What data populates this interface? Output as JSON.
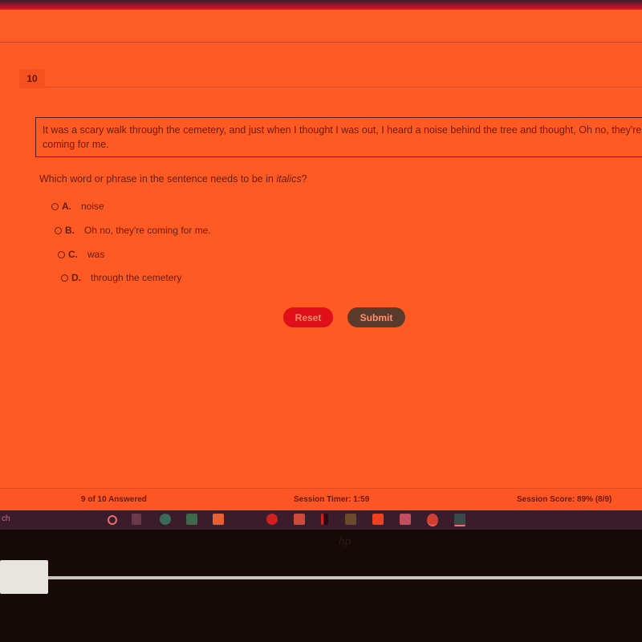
{
  "question": {
    "number": "10",
    "passage": "It was a scary walk through the cemetery, and just when I thought I was out, I heard a noise behind the tree and thought, Oh no, they're coming for me.",
    "prompt_before": "Which word or phrase in the sentence needs to be in ",
    "prompt_italic": "italics",
    "prompt_after": "?",
    "choices": [
      {
        "letter": "A.",
        "text": "noise"
      },
      {
        "letter": "B.",
        "text": "Oh no, they're coming for me."
      },
      {
        "letter": "C.",
        "text": "was"
      },
      {
        "letter": "D.",
        "text": "through the cemetery"
      }
    ]
  },
  "buttons": {
    "reset": "Reset",
    "submit": "Submit"
  },
  "footer": {
    "answered": "9 of 10 Answered",
    "timer": "Session Timer: 1:59",
    "score": "Session Score: 89% (8/9)"
  },
  "taskbar": {
    "search_text": "ch",
    "icons": [
      "cortana-icon",
      "task-view-icon",
      "edge-icon",
      "mail-icon",
      "store-icon",
      "app-icon",
      "expressvpn-icon",
      "file-explorer-icon",
      "netflix-icon",
      "zoom-icon",
      "sticky-notes-icon",
      "dropbox-icon",
      "chrome-icon",
      "photos-icon"
    ]
  },
  "brand": "hp"
}
